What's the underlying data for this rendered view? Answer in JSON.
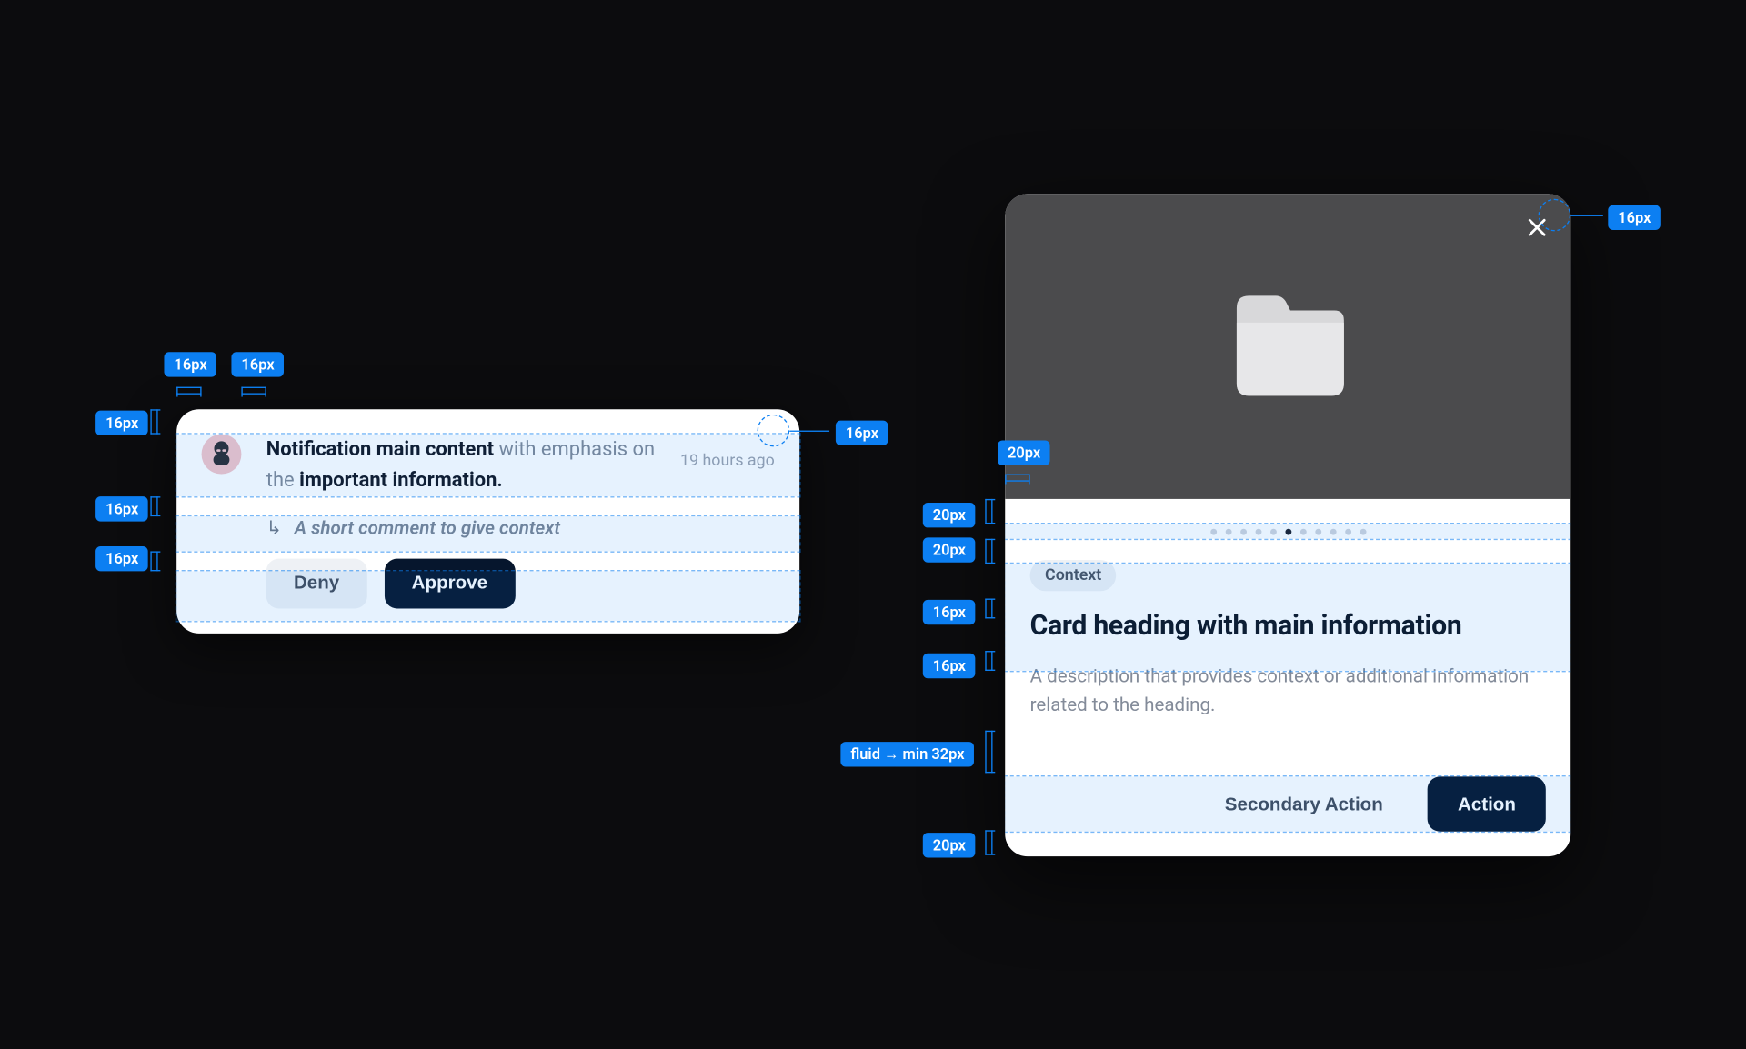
{
  "notification": {
    "text_strong_1": "Notification main content",
    "text_mid": " with emphasis on the ",
    "text_strong_2": "important information.",
    "timestamp": "19 hours ago",
    "comment": "A short comment to give context",
    "deny_label": "Deny",
    "approve_label": "Approve"
  },
  "card": {
    "chip_label": "Context",
    "heading": "Card heading with main information",
    "description": "A description that provides context or additional information related to the heading.",
    "secondary_label": "Secondary Action",
    "primary_label": "Action"
  },
  "spec": {
    "px16": "16px",
    "px20": "20px",
    "fluid": "fluid → min 32px"
  }
}
